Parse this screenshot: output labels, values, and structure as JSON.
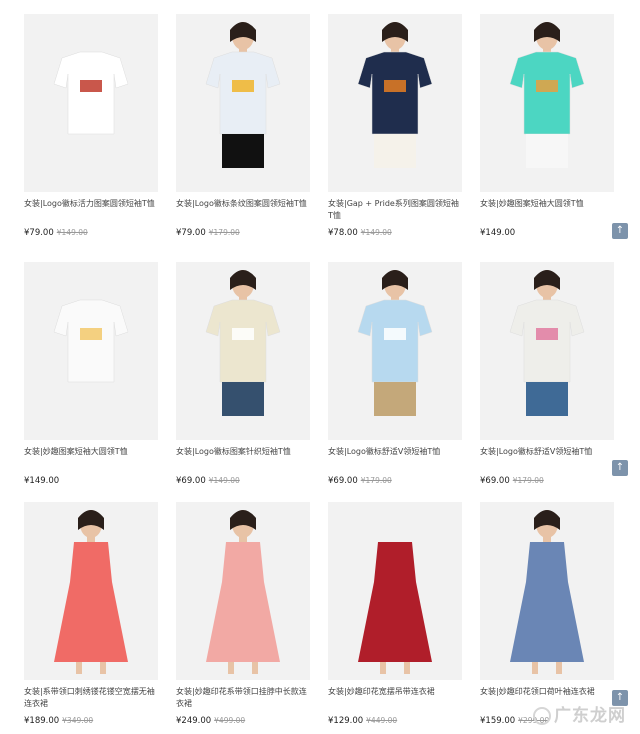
{
  "products": [
    {
      "title": "女装|Logo徽标活力图案圆领短袖T恤",
      "price": "¥79.00",
      "old_price": "¥149.00",
      "tag": "",
      "shirt": "#ffffff",
      "bottom": "#ffffff",
      "skin": false,
      "accent": "#c0392b"
    },
    {
      "title": "女装|Logo徽标条纹图案圆领短袖T恤",
      "price": "¥79.00",
      "old_price": "¥179.00",
      "tag": "",
      "shirt": "#e8eef5",
      "bottom": "#111111",
      "skin": true,
      "accent": "#f0b429"
    },
    {
      "title": "女装|Gap + Pride系列图案圆领短袖T恤",
      "price": "¥78.00",
      "old_price": "¥149.00",
      "tag": "",
      "shirt": "#1f2d4d",
      "bottom": "#f5f2ea",
      "skin": true,
      "accent": "#e67e22"
    },
    {
      "title": "女装|妙趣图案短袖大圆领T恤",
      "price": "¥149.00",
      "old_price": "",
      "tag": "",
      "shirt": "#4cd6c2",
      "bottom": "#f7f7f7",
      "skin": true,
      "accent": "#e6a040"
    },
    {
      "title": "女装|妙趣图案短袖大圆领T恤",
      "price": "¥149.00",
      "old_price": "",
      "tag": "",
      "shirt": "#fafafa",
      "bottom": "#fafafa",
      "skin": false,
      "accent": "#f2c86a"
    },
    {
      "title": "女装|Logo徽标图案针织短袖T恤",
      "price": "¥69.00",
      "old_price": "¥149.00",
      "tag": "",
      "shirt": "#ece6cf",
      "bottom": "#35506e",
      "skin": true,
      "accent": "#ffffff"
    },
    {
      "title": "女装|Logo徽标舒适V领短袖T恤",
      "price": "¥69.00",
      "old_price": "¥179.00",
      "tag": "",
      "shirt": "#b7d9ef",
      "bottom": "#c4a87a",
      "skin": true,
      "accent": "#ffffff"
    },
    {
      "title": "女装|Logo徽标舒适V领短袖T恤",
      "price": "¥69.00",
      "old_price": "¥179.00",
      "tag": "",
      "shirt": "#eeeeea",
      "bottom": "#3f6a96",
      "skin": true,
      "accent": "#e07aa0"
    },
    {
      "title": "女装|系带领口刺绣镂花镂空宽摆无袖连衣裙",
      "price": "¥189.00",
      "old_price": "¥349.00",
      "tag": "",
      "shirt": "#f06b66",
      "bottom": "#f06b66",
      "skin": true,
      "accent": "#f06b66"
    },
    {
      "title": "女装|妙趣印花系带领口挂脖中长款连衣裙",
      "price": "¥249.00",
      "old_price": "¥499.00",
      "tag": "",
      "shirt": "#f2a9a4",
      "bottom": "#f2a9a4",
      "skin": true,
      "accent": "#f2a9a4"
    },
    {
      "title": "女装|妙趣印花宽摆吊带连衣裙",
      "price": "¥129.00",
      "old_price": "¥449.00",
      "tag": "",
      "shirt": "#b01e2a",
      "bottom": "#b01e2a",
      "skin": false,
      "accent": "#b01e2a"
    },
    {
      "title": "女装|妙趣印花领口荷叶袖连衣裙",
      "price": "¥159.00",
      "old_price": "¥299.00",
      "tag": "",
      "shirt": "#6a86b5",
      "bottom": "#6a86b5",
      "skin": true,
      "accent": "#6a86b5"
    }
  ],
  "scroll_top_label": "↑",
  "watermark_text": "广东龙网"
}
